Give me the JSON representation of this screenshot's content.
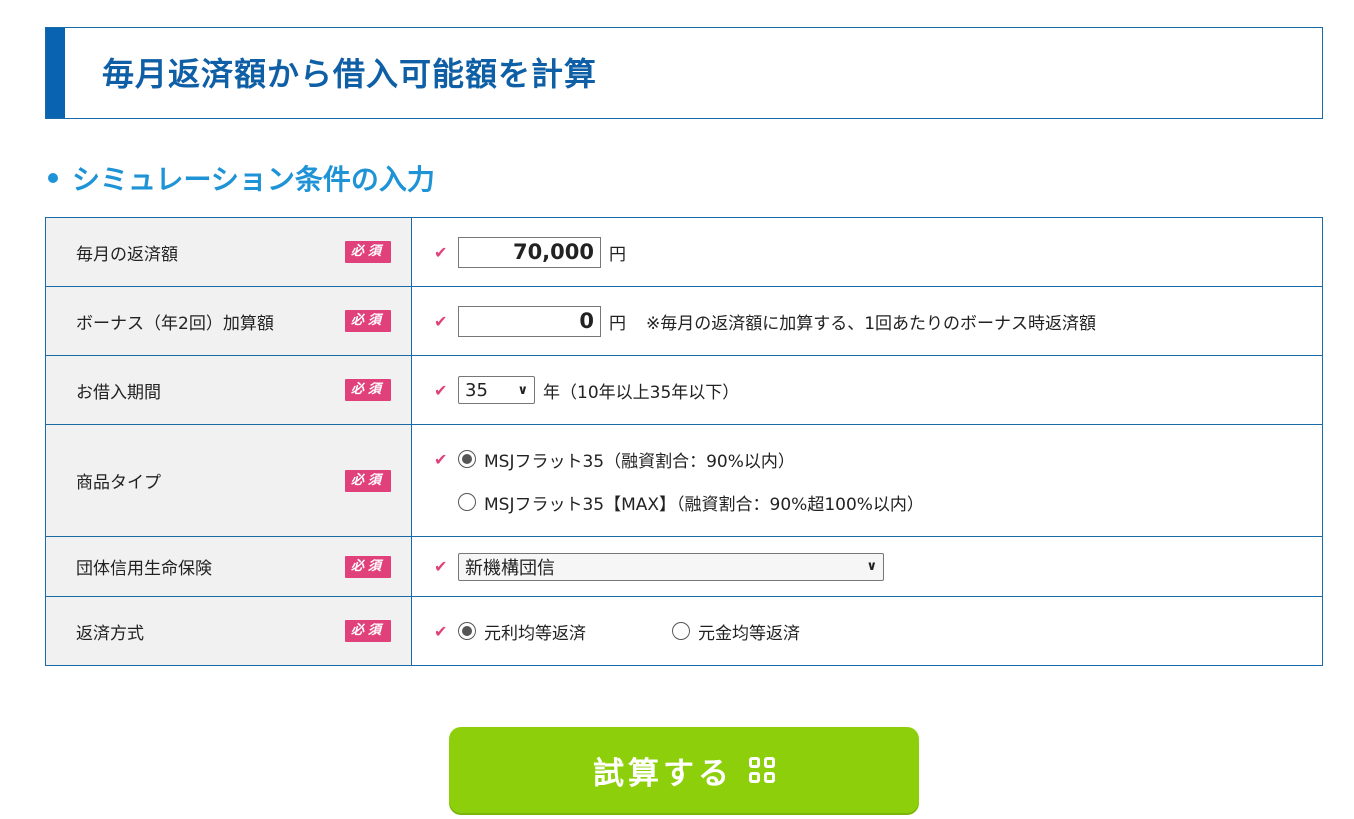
{
  "page_title": "毎月返済額から借入可能額を計算",
  "section_heading": "シミュレーション条件の入力",
  "required_badge": "必須",
  "rows": {
    "monthly": {
      "label": "毎月の返済額",
      "value": "70,000",
      "unit": "円"
    },
    "bonus": {
      "label": "ボーナス（年2回）加算額",
      "value": "0",
      "unit": "円",
      "note": "※毎月の返済額に加算する、1回あたりのボーナス時返済額"
    },
    "term": {
      "label": "お借入期間",
      "selected": "35",
      "note": "年（10年以上35年以下）"
    },
    "product": {
      "label": "商品タイプ",
      "options": [
        "MSJフラット35（融資割合：90%以内）",
        "MSJフラット35【MAX】（融資割合：90%超100%以内）"
      ],
      "selected_index": 0
    },
    "insurance": {
      "label": "団体信用生命保険",
      "selected": "新機構団信"
    },
    "repayment": {
      "label": "返済方式",
      "options": [
        "元利均等返済",
        "元金均等返済"
      ],
      "selected_index": 0
    }
  },
  "calc_button": "試算する",
  "colors": {
    "title": "#0f5fa6",
    "accent": "#1e93d6",
    "required": "#e0417a",
    "button": "#8ecf0b",
    "border": "#1a6aa8"
  }
}
